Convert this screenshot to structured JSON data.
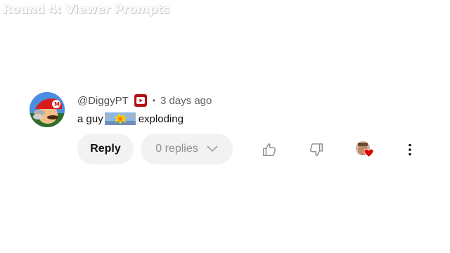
{
  "overlay": {
    "title": "Round 4: Viewer Prompts"
  },
  "comment": {
    "author": "@DiggyPT",
    "badge": "member-badge-icon",
    "separator": "•",
    "timestamp": "3 days ago",
    "text_before": "a guy",
    "emote": "exploding-emote",
    "text_after": "exploding",
    "reply_label": "Reply",
    "replies_label": "0 replies",
    "hearted_by_creator": true
  },
  "colors": {
    "badge_red": "#b31212",
    "heart_red": "#e00000",
    "pill_bg": "#f2f2f2",
    "muted_text": "#606060"
  }
}
